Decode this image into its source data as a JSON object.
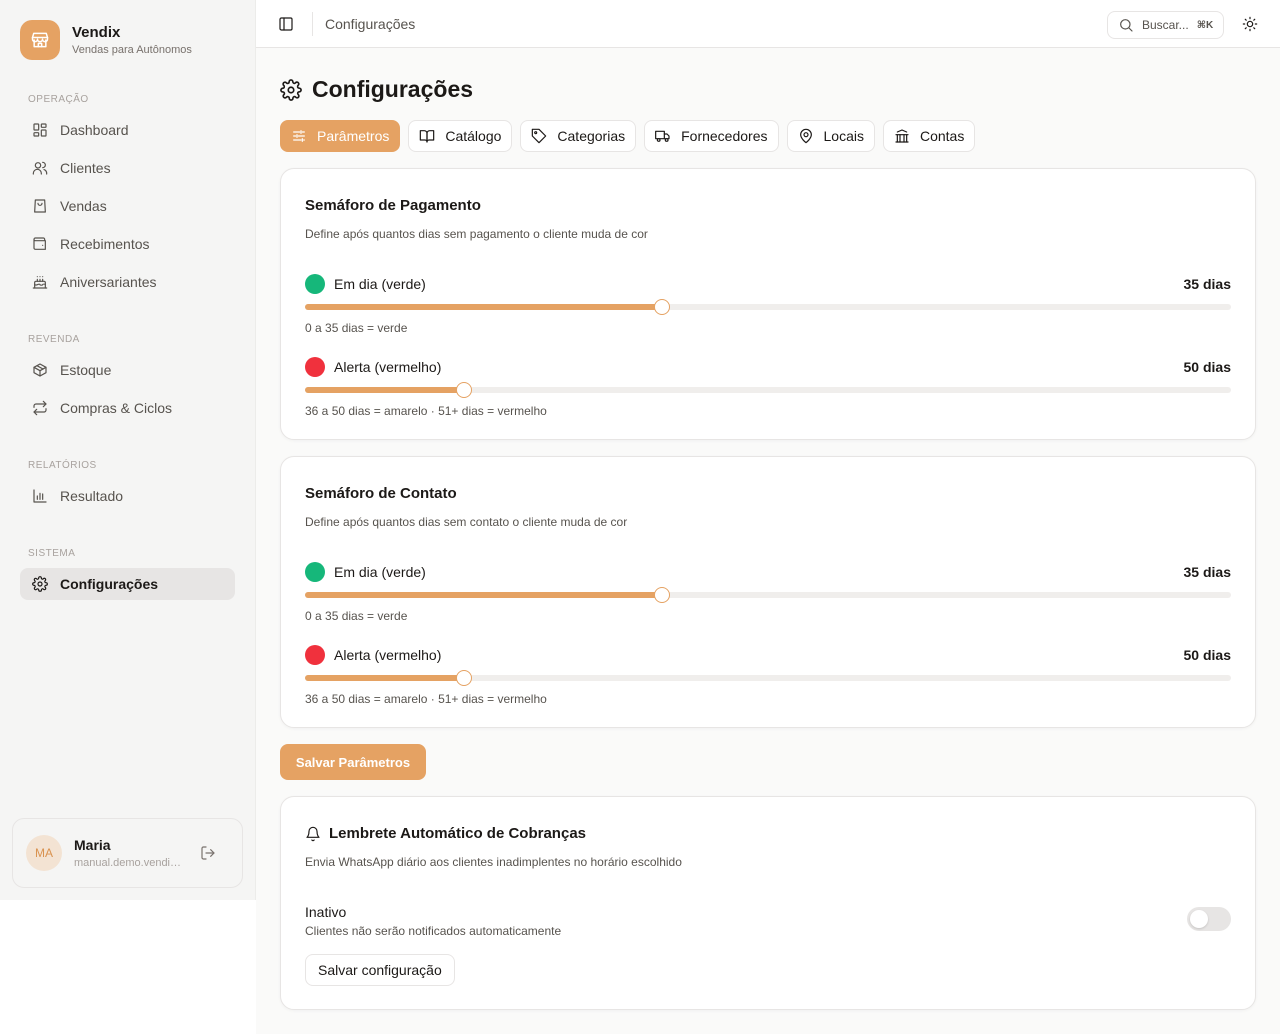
{
  "brand": {
    "name": "Vendix",
    "subtitle": "Vendas para Autônomos"
  },
  "sidebar": {
    "sections": [
      {
        "label": "OPERAÇÃO",
        "items": [
          {
            "label": "Dashboard",
            "icon": "layout-grid-icon"
          },
          {
            "label": "Clientes",
            "icon": "users-icon"
          },
          {
            "label": "Vendas",
            "icon": "shopping-bag-icon"
          },
          {
            "label": "Recebimentos",
            "icon": "wallet-icon"
          },
          {
            "label": "Aniversariantes",
            "icon": "cake-icon"
          }
        ]
      },
      {
        "label": "REVENDA",
        "items": [
          {
            "label": "Estoque",
            "icon": "package-icon"
          },
          {
            "label": "Compras & Ciclos",
            "icon": "repeat-icon"
          }
        ]
      },
      {
        "label": "RELATÓRIOS",
        "items": [
          {
            "label": "Resultado",
            "icon": "bar-chart-icon"
          }
        ]
      },
      {
        "label": "SISTEMA",
        "items": [
          {
            "label": "Configurações",
            "icon": "gear-icon",
            "active": true
          }
        ]
      }
    ],
    "user": {
      "initials": "MA",
      "name": "Maria",
      "email": "manual.demo.vendix@gmail.com"
    }
  },
  "topbar": {
    "title": "Configurações",
    "search_placeholder": "Buscar...",
    "shortcut": "⌘K"
  },
  "page": {
    "title": "Configurações",
    "tabs": [
      {
        "label": "Parâmetros",
        "icon": "sliders-icon",
        "active": true
      },
      {
        "label": "Catálogo",
        "icon": "book-open-icon"
      },
      {
        "label": "Categorias",
        "icon": "tag-icon"
      },
      {
        "label": "Fornecedores",
        "icon": "truck-icon"
      },
      {
        "label": "Locais",
        "icon": "map-pin-icon"
      },
      {
        "label": "Contas",
        "icon": "bank-icon"
      }
    ]
  },
  "payment_card": {
    "title": "Semáforo de Pagamento",
    "description": "Define após quantos dias sem pagamento o cliente muda de cor",
    "green": {
      "label": "Em dia (verde)",
      "value": "35 dias",
      "level": 0.385,
      "hint": "0 a 35 dias = verde",
      "color": "#16b77a"
    },
    "red": {
      "label": "Alerta (vermelho)",
      "value": "50 dias",
      "level": 0.172,
      "hint": "36 a 50 dias = amarelo · 51+ dias = vermelho",
      "color": "#f0313d"
    }
  },
  "contact_card": {
    "title": "Semáforo de Contato",
    "description": "Define após quantos dias sem contato o cliente muda de cor",
    "green": {
      "label": "Em dia (verde)",
      "value": "35 dias",
      "level": 0.385,
      "hint": "0 a 35 dias = verde",
      "color": "#16b77a"
    },
    "red": {
      "label": "Alerta (vermelho)",
      "value": "50 dias",
      "level": 0.172,
      "hint": "36 a 50 dias = amarelo · 51+ dias = vermelho",
      "color": "#f0313d"
    }
  },
  "save_params_label": "Salvar Parâmetros",
  "reminder_card": {
    "title": "Lembrete Automático de Cobranças",
    "description": "Envia WhatsApp diário aos clientes inadimplentes no horário escolhido",
    "status": "Inativo",
    "status_desc": "Clientes não serão notificados automaticamente",
    "enabled": false,
    "save_label": "Salvar configuração"
  },
  "colors": {
    "accent": "#e5a263"
  }
}
